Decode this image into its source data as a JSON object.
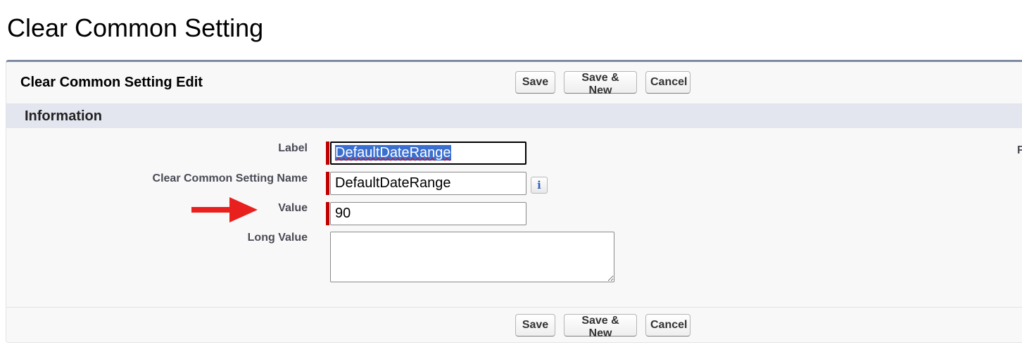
{
  "page": {
    "title": "Clear Common Setting"
  },
  "panel": {
    "title": "Clear Common Setting Edit",
    "buttons": {
      "save": "Save",
      "save_new": "Save & New",
      "cancel": "Cancel"
    }
  },
  "section": {
    "title": "Information",
    "right_label_fragment": "F"
  },
  "fields": {
    "label": {
      "label": "Label",
      "value": "DefaultDateRange",
      "required": true,
      "focused": true
    },
    "name": {
      "label": "Clear Common Setting Name",
      "value": "DefaultDateRange",
      "required": true,
      "help_icon": "info-icon",
      "help_glyph": "i"
    },
    "value": {
      "label": "Value",
      "value": "90",
      "required": true
    },
    "long_value": {
      "label": "Long Value",
      "value": ""
    }
  },
  "annotation": {
    "icon": "red-arrow-icon",
    "color": "#e8211f"
  },
  "colors": {
    "required_marker": "#c00000",
    "panel_border_top": "#7f8ba3",
    "section_bar": "#e3e6ef",
    "selection": "#3a6fd0"
  }
}
